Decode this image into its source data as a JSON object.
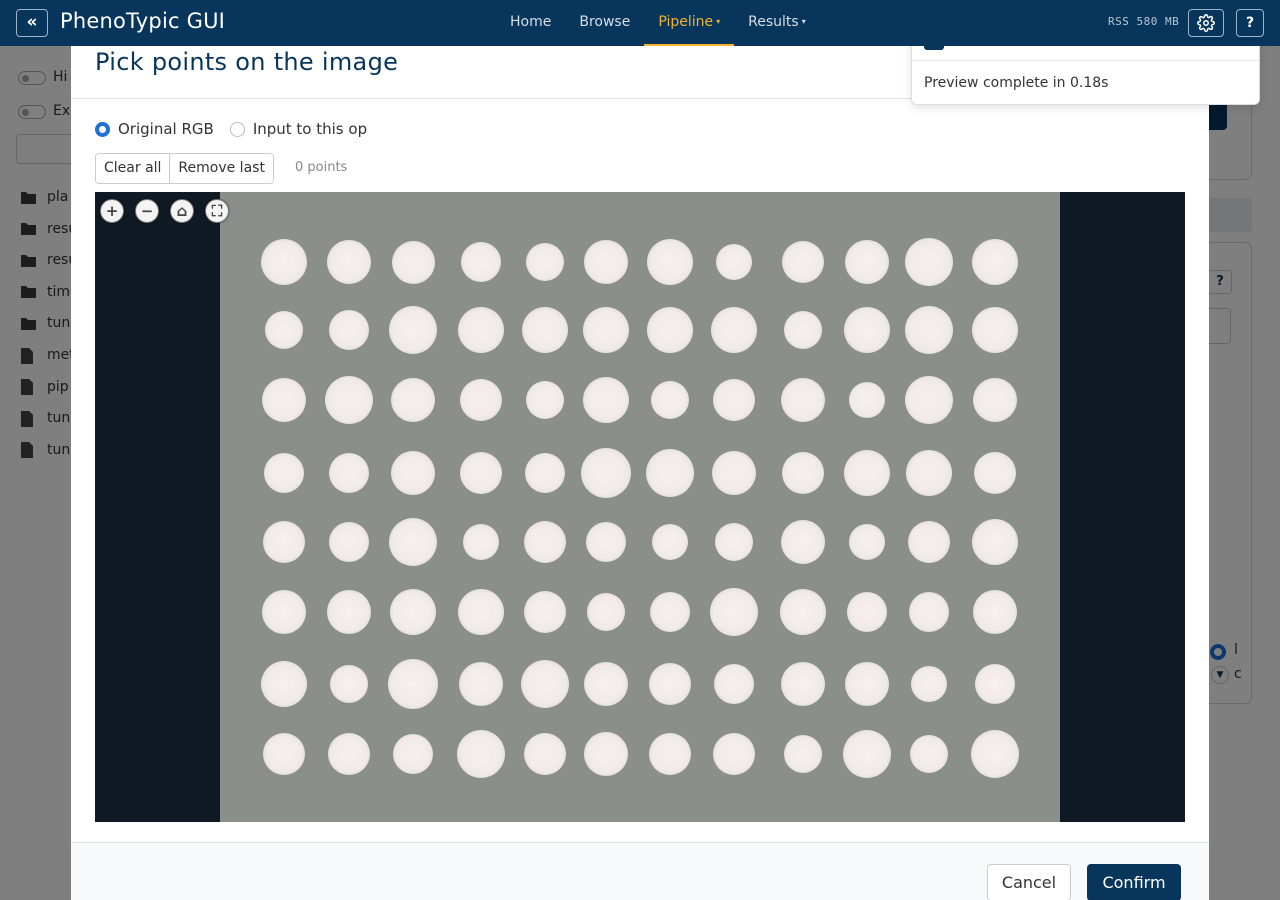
{
  "navbar": {
    "collapse_glyph": "«",
    "brand": "PhenoTypic GUI",
    "links": [
      {
        "label": "Home",
        "active": false,
        "dropdown": false
      },
      {
        "label": "Browse",
        "active": false,
        "dropdown": false
      },
      {
        "label": "Pipeline",
        "active": true,
        "dropdown": true
      },
      {
        "label": "Results",
        "active": false,
        "dropdown": true
      }
    ],
    "caret_glyph": "▾",
    "memory": "RSS 580 MB",
    "settings_icon": "gear-icon",
    "help_label": "?"
  },
  "background": {
    "toggles": [
      "Hi",
      "Ex"
    ],
    "files": [
      {
        "name": "pla",
        "type": "folder"
      },
      {
        "name": "resu",
        "type": "folder"
      },
      {
        "name": "resu",
        "type": "folder"
      },
      {
        "name": "time",
        "type": "folder"
      },
      {
        "name": "tun",
        "type": "folder"
      },
      {
        "name": "met",
        "type": "file"
      },
      {
        "name": "pip",
        "type": "file"
      },
      {
        "name": "tun",
        "type": "file"
      },
      {
        "name": "tun",
        "type": "file"
      }
    ],
    "help_q": "?",
    "radio_label": "l",
    "dropdown_label": "c"
  },
  "modal": {
    "title": "Pick points on the image",
    "source_options": [
      {
        "label": "Original RGB",
        "checked": true
      },
      {
        "label": "Input to this op",
        "checked": false
      }
    ],
    "clear_all": "Clear all",
    "remove_last": "Remove last",
    "point_count": "0 points",
    "viewer_controls": [
      {
        "name": "zoom-in-icon",
        "glyph": "+"
      },
      {
        "name": "zoom-out-icon",
        "glyph": "−"
      },
      {
        "name": "home-icon",
        "glyph": "⌂"
      },
      {
        "name": "fullscreen-icon",
        "glyph": "⛶"
      }
    ],
    "plate": {
      "rows": 8,
      "cols": 12
    },
    "cancel": "Cancel",
    "confirm": "Confirm"
  },
  "toast": {
    "message": "Preview complete in 0.18s",
    "close_glyph": "×"
  },
  "colors": {
    "navbar": "#08355c",
    "accent": "#f2b431",
    "primary": "#1e6fd9",
    "plate": "#8b8f8c",
    "viewer_bg": "#101a24"
  }
}
